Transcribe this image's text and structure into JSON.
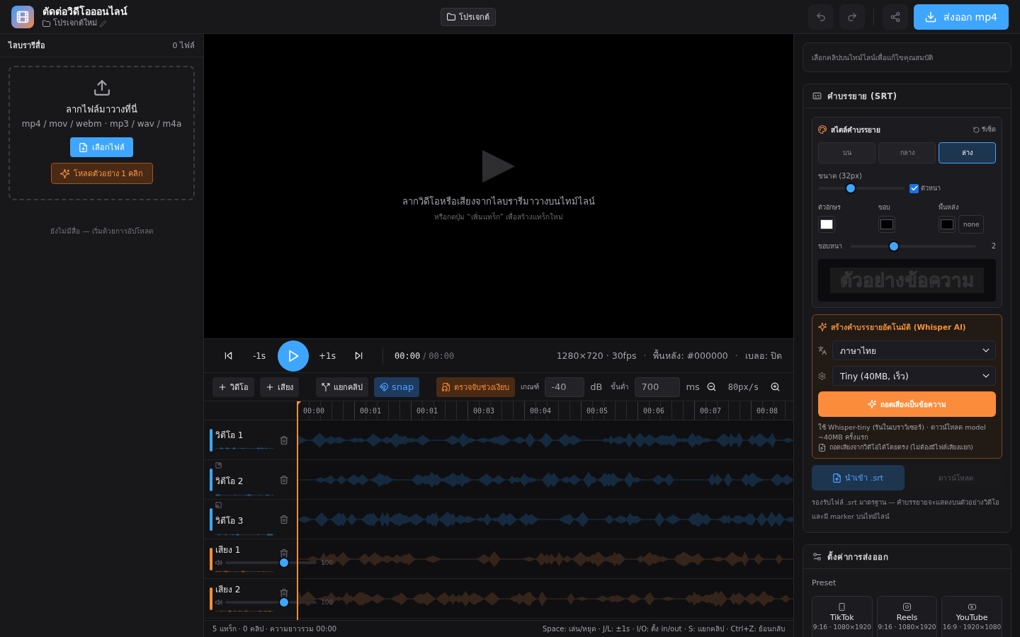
{
  "header": {
    "title": "ตัดต่อวิดีโอออนไลน์",
    "project_name": "โปรเจกต์ใหม่",
    "projects_button": "โปรเจกต์",
    "export_button": "ส่งออก mp4"
  },
  "library": {
    "title": "ไลบรารีสื่อ",
    "count": "0 ไฟล์",
    "dropzone": {
      "title": "ลากไฟล์มาวางที่นี่",
      "formats": "mp4 / mov / webm · mp3 / wav / m4a",
      "choose_button": "เลือกไฟล์",
      "sample_button": "โหลดตัวอย่าง 1 คลิก"
    },
    "empty_message": "ยังไม่มีสื่อ — เริ่มด้วยการอัปโหลด"
  },
  "preview": {
    "message": "ลากวิดีโอหรือเสียงจากไลบรารีมาวางบนไทม์ไลน์",
    "hint": "หรือกดปุ่ม “เพิ่มแทร็ก” เพื่อสร้างแทร็กใหม่"
  },
  "transport": {
    "back_button": "-1s",
    "forward_button": "+1s",
    "current_time": "00:00",
    "time_separator": "/",
    "duration": "00:00",
    "info": [
      {
        "kind": "text",
        "text": "1280×720 · 30fps"
      },
      {
        "kind": "separator",
        "text": "·"
      },
      {
        "kind": "text",
        "text": "พื้นหลัง: #000000"
      },
      {
        "kind": "separator",
        "text": "·"
      },
      {
        "kind": "text",
        "text": "เบลอ: ปิด"
      }
    ]
  },
  "toolbar": {
    "add_video": "วิดีโอ",
    "add_audio": "เสียง",
    "split": "แยกคลิป",
    "snap": {
      "label": "snap",
      "on": true
    },
    "detect_silence": "ตรวจจับช่วงเงียบ",
    "threshold": {
      "label": "เกณฑ์",
      "value": "-40",
      "unit": "dB"
    },
    "minimum": {
      "label": "ขั้นต่ำ",
      "value": "700",
      "unit": "ms"
    },
    "zoom": "80px/s"
  },
  "timeline": {
    "ticks": [
      "00:00",
      "00:01",
      "00:01",
      "00:03",
      "00:04",
      "00:05",
      "00:06",
      "00:07",
      "00:08"
    ],
    "tracks": [
      {
        "kind": "video",
        "name": "วิดีโอ 1"
      },
      {
        "kind": "video",
        "name": "วิดีโอ 2",
        "overlay": {
          "kind": "top-right"
        }
      },
      {
        "kind": "video",
        "name": "วิดีโอ 3",
        "overlay": {
          "kind": "bottom-left"
        }
      },
      {
        "kind": "audio",
        "name": "เสียง 1",
        "volume": {
          "level": 0.64,
          "reading": "100"
        }
      },
      {
        "kind": "audio",
        "name": "เสียง 2",
        "volume": {
          "level": 0.64,
          "reading": "100"
        }
      }
    ]
  },
  "status_bar": {
    "summary": "5 แทร็ก · 0 คลิป · ความยาวรวม 00:00",
    "shortcuts": "Space: เล่น/หยุด · J/L: ±1s · I/O: ตั้ง in/out · S: แยกคลิป · Ctrl+Z: ย้อนกลับ"
  },
  "properties": {
    "hint": "เลือกคลิปบนไทม์ไลน์เพื่อแก้ไขคุณสมบัติ"
  },
  "subtitles": {
    "title": "คำบรรยาย (SRT)",
    "style": {
      "title": "สไตล์คำบรรยาย",
      "reset": "รีเซ็ต",
      "positions": [
        {
          "label": "บน",
          "selected": false
        },
        {
          "label": "กลาง",
          "selected": false
        },
        {
          "label": "ล่าง",
          "selected": true
        }
      ],
      "size": {
        "label": "ขนาด (32px)",
        "level": 0.38
      },
      "bold": {
        "label": "ตัวหนา",
        "checked": true
      },
      "colors": [
        {
          "label": "ตัวอักษร",
          "color": "#ffffff"
        },
        {
          "label": "ขอบ",
          "color": "#000000"
        },
        {
          "label": "พื้นหลัง",
          "color": "#000000",
          "none_button": "none"
        }
      ],
      "outline": {
        "label": "ขอบหนา",
        "level": 0.35,
        "reading": "2"
      },
      "sample_text": "ตัวอย่างข้อความ"
    },
    "whisper": {
      "title": "สร้างคำบรรยายอัตโนมัติ (Whisper AI)",
      "language": "ภาษาไทย",
      "model": "Tiny (40MB, เร็ว)",
      "transcribe_button": "ถอดเสียงเป็นข้อความ",
      "note": "ใช้ Whisper-tiny (รันในเบราว์เซอร์) · ดาวน์โหลด model ~40MB ครั้งแรก",
      "video_note": "ถอดเสียงจากวิดีโอได้โดยตรง (ไม่ต้องมีไฟล์เสียงแยก)"
    },
    "import_button": "นำเข้า .srt",
    "download_button": {
      "label": "ดาวน์โหลด",
      "disabled": true
    },
    "help": "รองรับไฟล์ .srt มาตรฐาน — คำบรรยายจะแสดงบนตัวอย่างวิดีโอและมี marker บนไทม์ไลน์"
  },
  "export": {
    "title": "ตั้งค่าการส่งออก",
    "preset_label": "Preset",
    "presets": [
      {
        "name": "TikTok",
        "spec": "9:16 · 1080×1920",
        "selected": false
      },
      {
        "name": "Reels",
        "spec": "9:16 · 1080×1920",
        "selected": false
      },
      {
        "name": "YouTube",
        "spec": "16:9 · 1920×1080",
        "selected": false
      }
    ]
  }
}
